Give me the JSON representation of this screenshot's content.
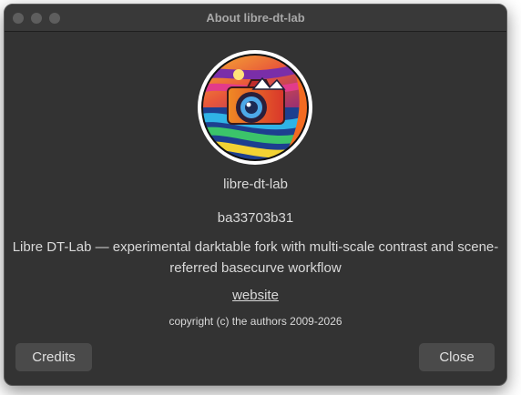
{
  "window": {
    "title": "About libre-dt-lab"
  },
  "app": {
    "name": "libre-dt-lab",
    "version": "ba33703b31",
    "description": "Libre DT-Lab — experimental darktable fork with multi-scale contrast and scene-referred basecurve workflow",
    "website_label": "website",
    "copyright": "copyright (c) the authors 2009-2026",
    "logo_icon": "camera-swirl-logo-icon"
  },
  "buttons": {
    "credits_label": "Credits",
    "close_label": "Close"
  },
  "colors": {
    "window_bg": "#333333",
    "button_bg": "#4a4a4a",
    "text": "#d9d9d9"
  }
}
